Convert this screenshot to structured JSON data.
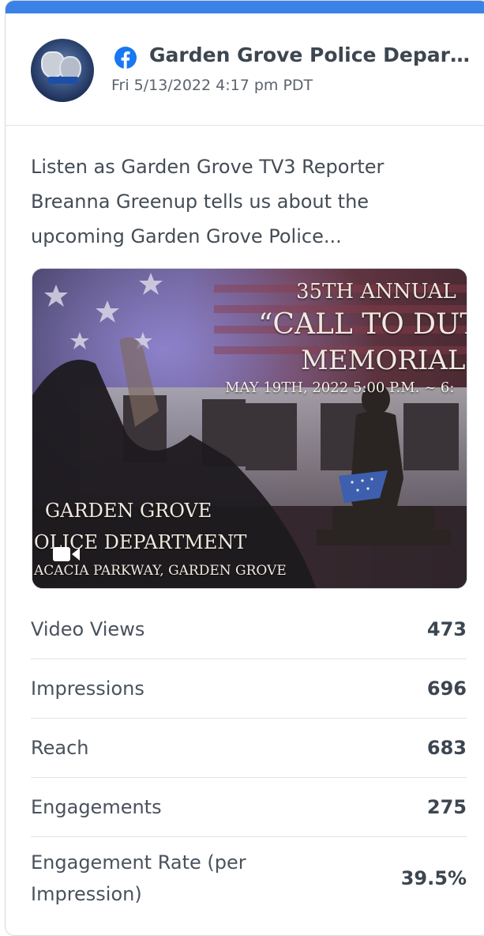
{
  "card": {
    "accent_color": "#3b82e6"
  },
  "post": {
    "page_name": "Garden Grove Police Department",
    "timestamp": "Fri 5/13/2022 4:17 pm PDT",
    "platform_icon": "facebook-icon",
    "text": "Listen as Garden Grove TV3 Reporter Breanna Greenup tells us about the upcoming Garden Grove Police..."
  },
  "media": {
    "type": "video",
    "icon": "video-camera-icon",
    "overlay": {
      "line1": "35TH ANNUAL",
      "line2": "“CALL TO DUT",
      "line3": "MEMORIAL",
      "date": "MAY 19TH, 2022  5:00 P.M. ~ 6:",
      "org_line1": "GARDEN GROVE",
      "org_line2": "OLICE DEPARTMENT",
      "address": "ACACIA PARKWAY, GARDEN GROVE"
    }
  },
  "stats": [
    {
      "label": "Video Views",
      "value": "473"
    },
    {
      "label": "Impressions",
      "value": "696"
    },
    {
      "label": "Reach",
      "value": "683"
    },
    {
      "label": "Engagements",
      "value": "275"
    },
    {
      "label": "Engagement Rate (per Impression)",
      "value": "39.5%"
    }
  ]
}
